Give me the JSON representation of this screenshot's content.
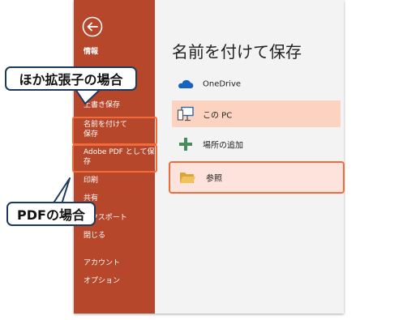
{
  "sidebar": {
    "items": [
      {
        "label": "情報"
      },
      {
        "label": "上書き保存"
      },
      {
        "label": "名前を付けて"
      },
      {
        "label": "保存"
      },
      {
        "label": "Adobe PDF として保"
      },
      {
        "label": "存"
      },
      {
        "label": "印刷"
      },
      {
        "label": "共有"
      },
      {
        "label": "エクスポート"
      },
      {
        "label": "閉じる"
      },
      {
        "label": "アカウント"
      },
      {
        "label": "オプション"
      }
    ]
  },
  "main": {
    "title": "名前を付けて保存",
    "options": [
      {
        "label": "OneDrive",
        "icon": "cloud-icon"
      },
      {
        "label": "この PC",
        "icon": "computer-icon"
      },
      {
        "label": "場所の追加",
        "icon": "plus-icon"
      },
      {
        "label": "参照",
        "icon": "folder-icon"
      }
    ]
  },
  "callouts": {
    "other_ext": "ほか拡張子の場合",
    "pdf": "PDFの場合"
  },
  "colors": {
    "sidebar": "#b7472a",
    "accent": "#f26b3a",
    "callout_border": "#1c3a5e"
  }
}
